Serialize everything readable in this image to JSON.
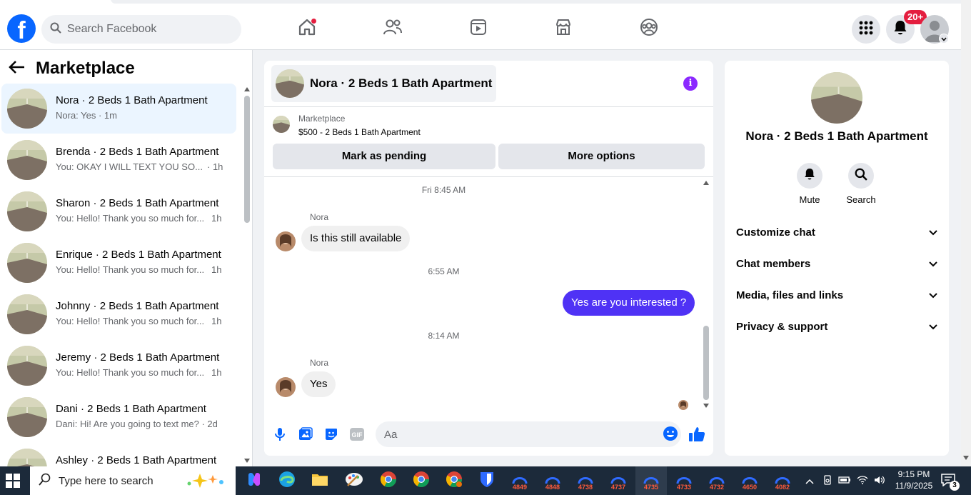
{
  "topbar": {
    "search_placeholder": "Search Facebook",
    "notification_count": "20+",
    "logo_letter": "f"
  },
  "left": {
    "title": "Marketplace",
    "conversations": [
      {
        "title": "Nora · 2 Beds 1 Bath Apartment",
        "preview": "Nora: Yes · 1m",
        "time": ""
      },
      {
        "title": "Brenda · 2 Beds 1 Bath Apartment",
        "preview": "You: OKAY I WILL TEXT YOU SO...",
        "time": "· 1h"
      },
      {
        "title": "Sharon · 2 Beds 1 Bath Apartment",
        "preview": "You: Hello! Thank you so much for...",
        "time": "1h"
      },
      {
        "title": "Enrique · 2 Beds 1 Bath Apartment",
        "preview": "You: Hello! Thank you so much for...",
        "time": "1h"
      },
      {
        "title": "Johnny · 2 Beds 1 Bath Apartment",
        "preview": "You: Hello! Thank you so much for...",
        "time": "1h"
      },
      {
        "title": "Jeremy · 2 Beds 1 Bath Apartment",
        "preview": "You: Hello! Thank you so much for...",
        "time": "1h"
      },
      {
        "title": "Dani · 2 Beds 1 Bath Apartment",
        "preview": "Dani: Hi! Are you going to text me? · 2d",
        "time": ""
      },
      {
        "title": "Ashley · 2 Beds 1 Bath Apartment",
        "preview": "",
        "time": ""
      }
    ]
  },
  "chat": {
    "title": "Nora · 2 Beds 1 Bath Apartment",
    "listing_label": "Marketplace",
    "listing_item": "$500 - 2 Beds 1 Bath Apartment",
    "mark_pending": "Mark as pending",
    "more_options": "More options",
    "info_glyph": "i",
    "messages": [
      {
        "timestamp": "Fri 8:45 AM",
        "sender": "Nora",
        "text": "Is this still available"
      },
      {
        "timestamp": "6:55 AM",
        "text": "Yes are you interested ?"
      },
      {
        "timestamp": "8:14 AM",
        "sender": "Nora",
        "text": "Yes"
      }
    ],
    "composer_placeholder": "Aa"
  },
  "right": {
    "name": "Nora · 2 Beds 1 Bath Apartment",
    "actions": [
      "Mute",
      "Search"
    ],
    "sections": [
      "Customize chat",
      "Chat members",
      "Media, files and links",
      "Privacy & support"
    ]
  },
  "taskbar": {
    "search_placeholder": "Type here to search",
    "apps": [
      "4849",
      "4848",
      "4738",
      "4737",
      "4735",
      "4733",
      "4732",
      "4650",
      "4082"
    ],
    "time": "9:15 PM",
    "date": "11/9/2025",
    "notifications": "3"
  },
  "colors": {
    "brand": "#0866ff",
    "outgoing_bubble": "#4f32f5",
    "badge": "#e41e3f",
    "info": "#8b29ff"
  },
  "icons": [
    "facebook-logo",
    "search-icon",
    "home-icon",
    "friends-icon",
    "video-icon",
    "marketplace-icon",
    "groups-icon",
    "menu-grid-icon",
    "bell-icon",
    "back-arrow-icon",
    "info-icon",
    "mic-icon",
    "photo-icon",
    "sticker-icon",
    "gif-icon",
    "emoji-icon",
    "like-icon",
    "chevron-down-icon"
  ]
}
